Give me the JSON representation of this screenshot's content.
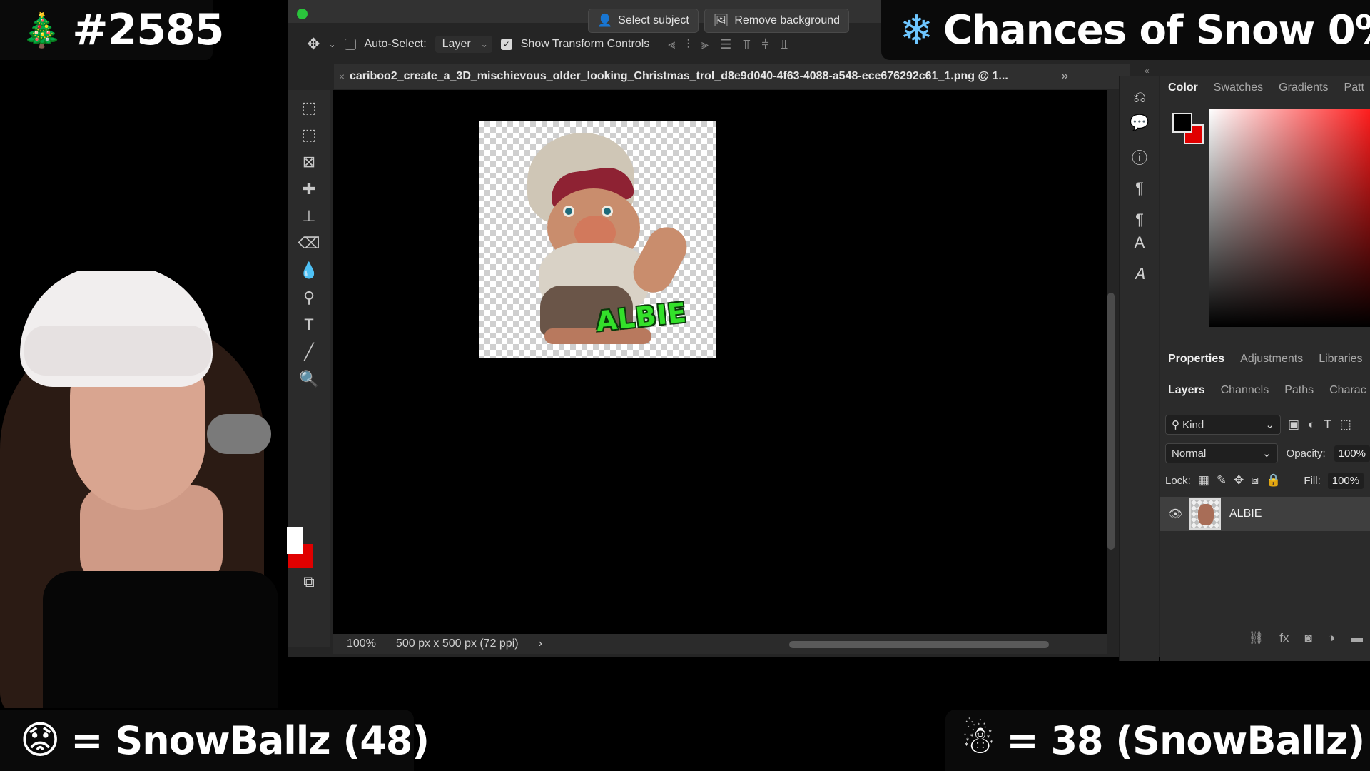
{
  "overlay": {
    "tree_emoji": "🎄",
    "stream_number": "#2585",
    "snowflake": "❄",
    "snow_text": "Chances of Snow 0%",
    "bottom_left_emoji": "😟",
    "bottom_left_text": "= SnowBallz (48)",
    "bottom_right_emoji": "☃",
    "bottom_right_text": "=  38 (SnowBallz)"
  },
  "photoshop": {
    "context_bar": {
      "select_subject": "Select subject",
      "remove_background": "Remove background"
    },
    "options": {
      "auto_select_label": "Auto-Select:",
      "auto_select_checked": false,
      "auto_select_target": "Layer",
      "show_transform_label": "Show Transform Controls",
      "show_transform_checked": true
    },
    "document_tab": {
      "title": "cariboo2_create_a_3D_mischievous_older_looking_Christmas_trol_d8e9d040-4f63-4088-a548-ece676292c61_1.png @ 1..."
    },
    "canvas": {
      "label_text": "ALBIE"
    },
    "status": {
      "zoom": "100%",
      "doc_info": "500 px x 500 px (72 ppi)"
    },
    "color_panel": {
      "tabs": [
        "Color",
        "Swatches",
        "Gradients",
        "Patt"
      ],
      "foreground": "#000000",
      "background": "#e00000"
    },
    "properties_panel": {
      "tabs": [
        "Properties",
        "Adjustments",
        "Libraries"
      ]
    },
    "layers_panel": {
      "tabs": [
        "Layers",
        "Channels",
        "Paths",
        "Charac"
      ],
      "filter_kind": "Kind",
      "blend_mode": "Normal",
      "opacity_label": "Opacity:",
      "opacity_value": "100%",
      "lock_label": "Lock:",
      "fill_label": "Fill:",
      "fill_value": "100%",
      "layers": [
        {
          "name": "ALBIE",
          "visible": true
        }
      ]
    },
    "accent_green": "#2ac43c"
  }
}
